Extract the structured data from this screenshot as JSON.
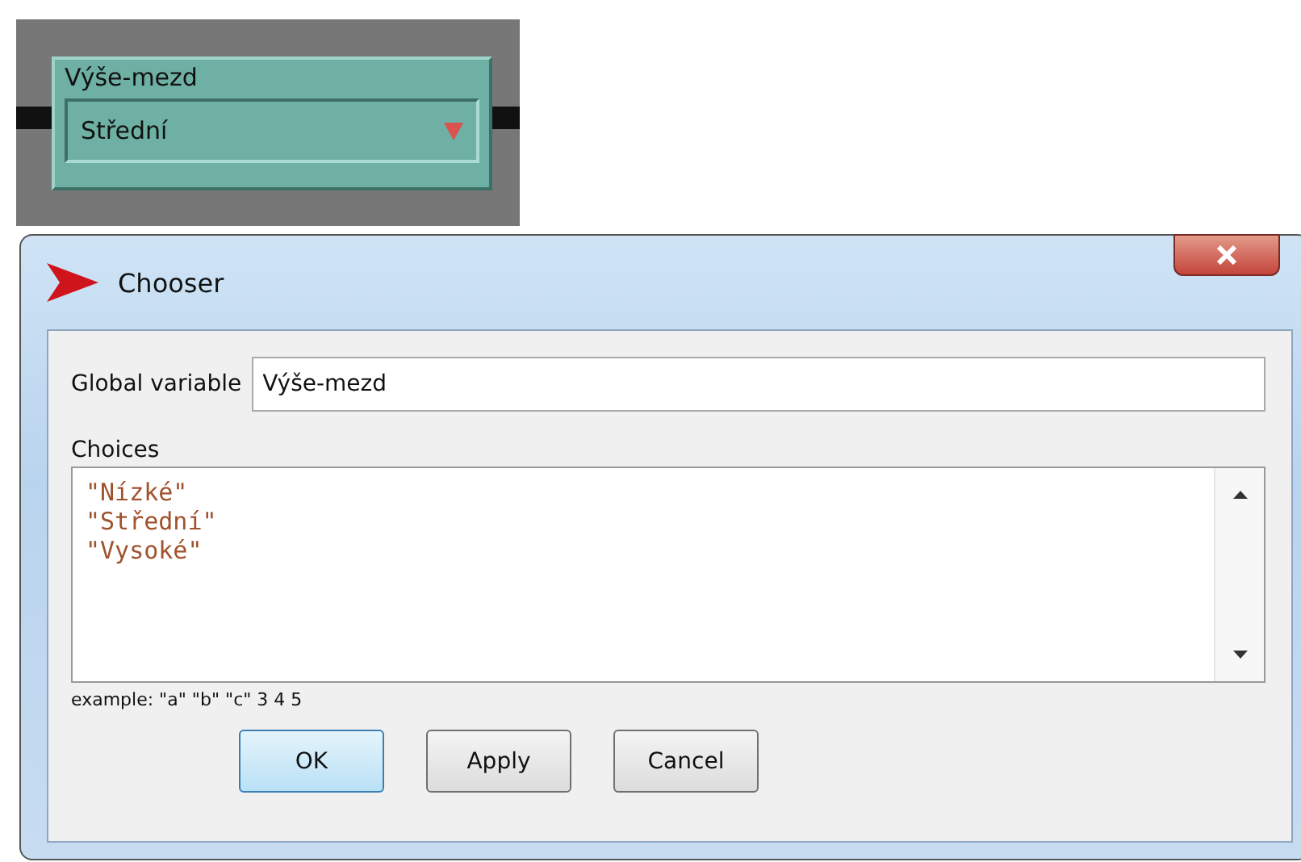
{
  "widget": {
    "label": "Výše-mezd",
    "value": "Střední"
  },
  "dialog": {
    "title": "Chooser",
    "global_variable": {
      "label": "Global variable",
      "value": "Výše-mezd"
    },
    "choices": {
      "label": "Choices",
      "lines": [
        "\"Nízké\"",
        "\"Střední\"",
        "\"Vysoké\""
      ]
    },
    "example": "example: \"a\" \"b\" \"c\" 3 4 5",
    "buttons": [
      {
        "label": "OK",
        "default": true
      },
      {
        "label": "Apply",
        "default": false
      },
      {
        "label": "Cancel",
        "default": false
      }
    ]
  }
}
